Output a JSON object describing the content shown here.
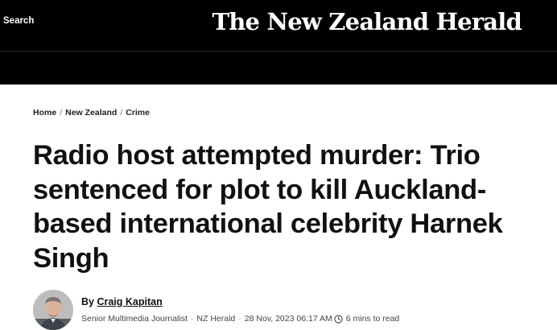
{
  "header": {
    "search_label": "Search",
    "masthead": "The New Zealand Herald"
  },
  "breadcrumb": {
    "items": [
      "Home",
      "New Zealand",
      "Crime"
    ],
    "separator": "/"
  },
  "article": {
    "headline": "Radio host attempted murder: Trio sentenced for plot to kill Auckland-based international celebrity Harnek Singh",
    "byline_prefix": "By",
    "author": "Craig Kapitan",
    "author_role": "Senior Multimedia Journalist",
    "publication": "NZ Herald",
    "date": "28 Nov, 2023 06:17 AM",
    "read_time": "6 mins to read",
    "meta_separator": "·"
  },
  "icons": {
    "clock": "clock-icon"
  },
  "colors": {
    "header_bg": "#000000",
    "header_text": "#ffffff",
    "body_bg": "#ffffff",
    "headline_text": "#111111"
  }
}
